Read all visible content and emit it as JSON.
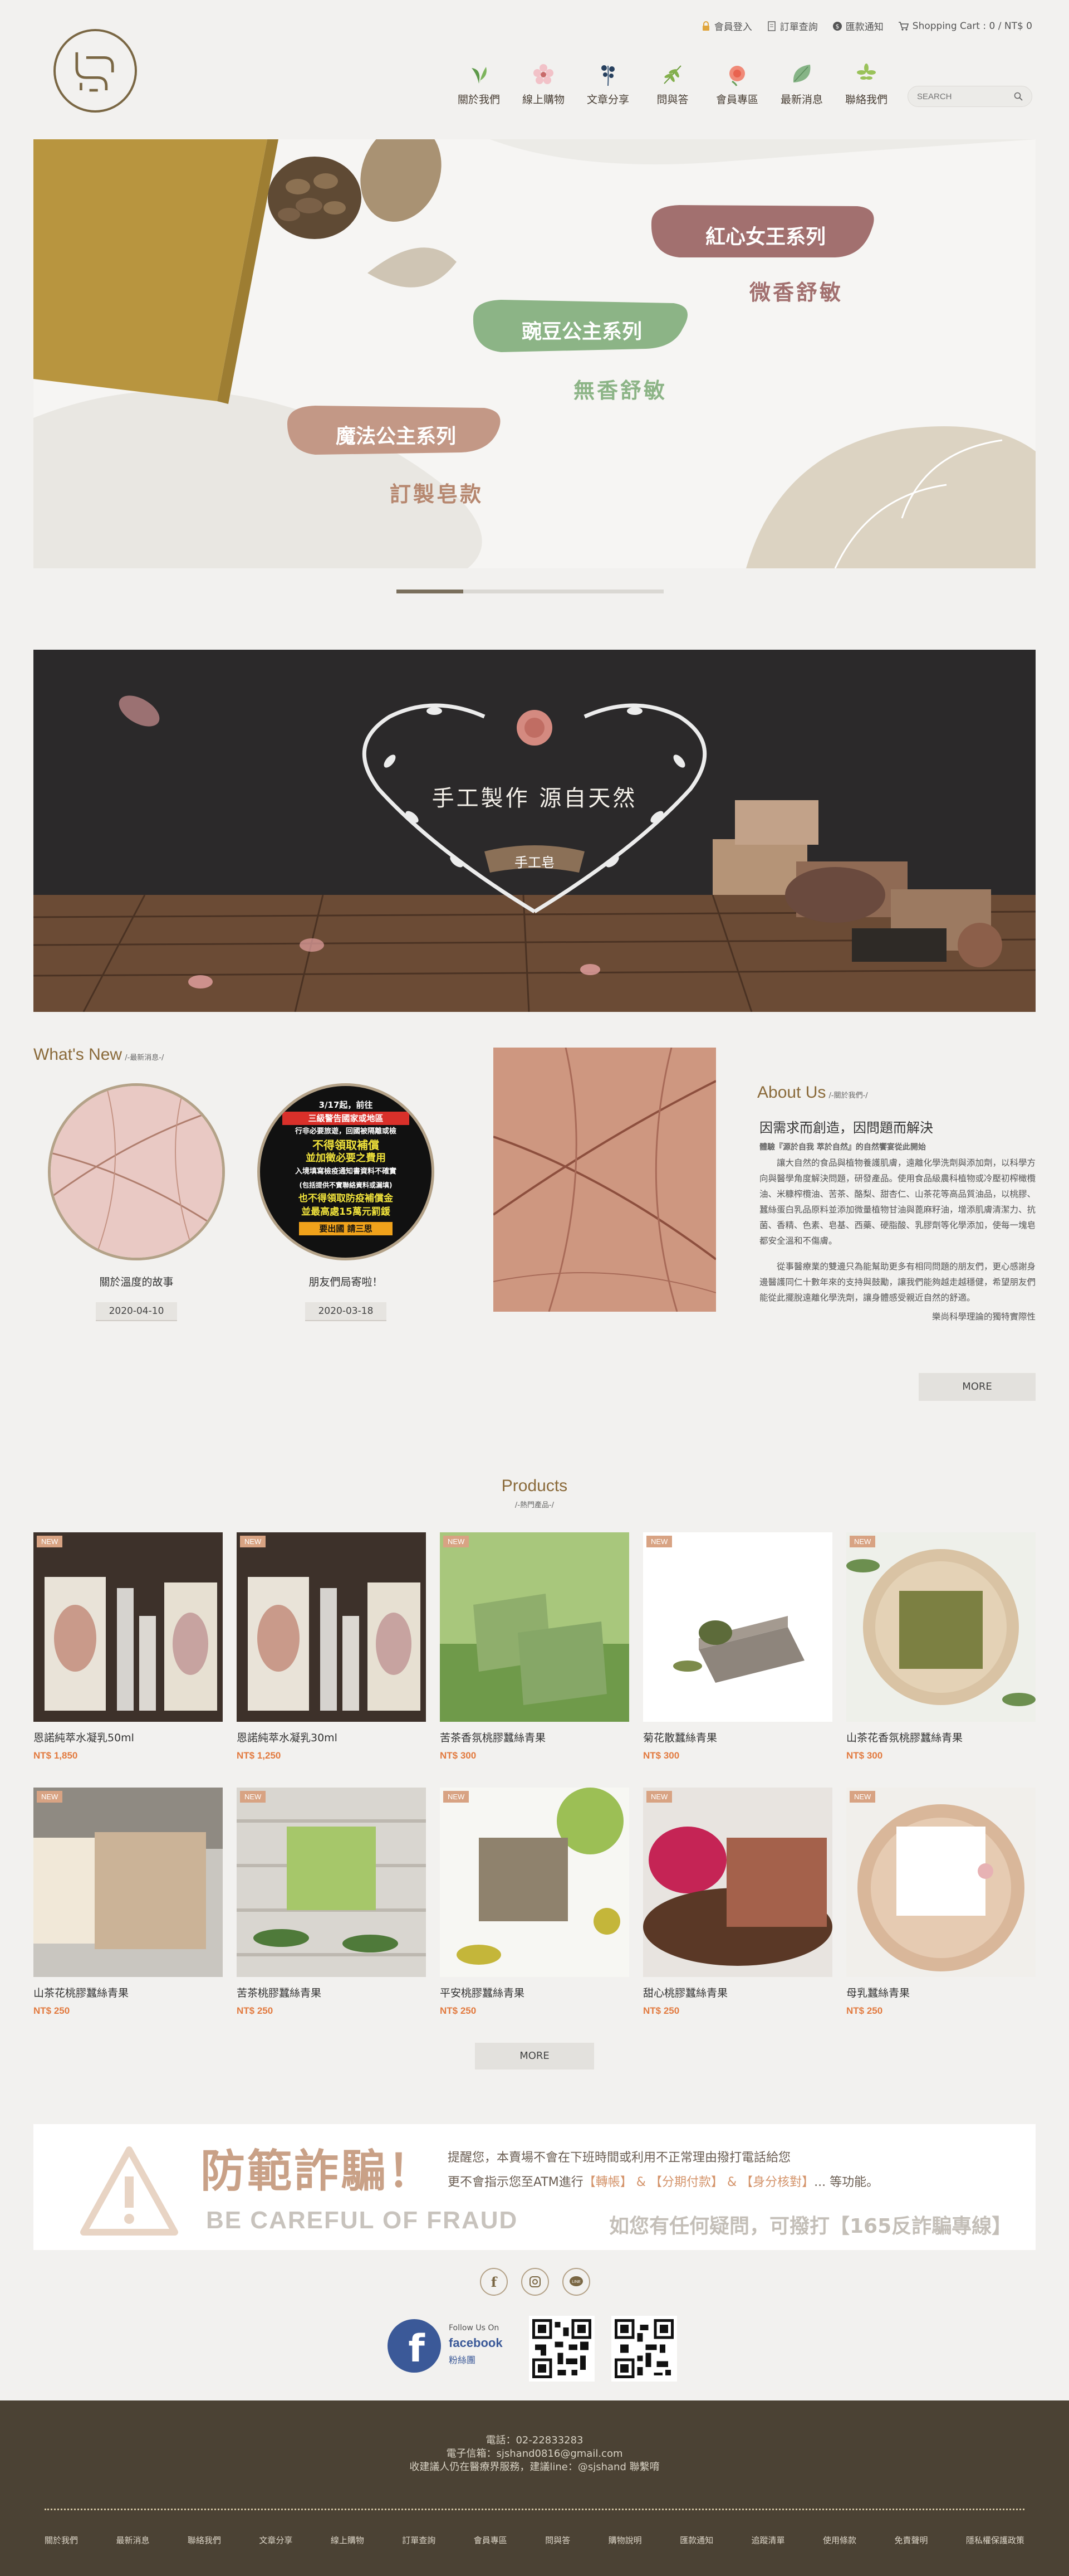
{
  "header": {
    "utility": [
      {
        "label": "會員登入",
        "icon": "lock-icon"
      },
      {
        "label": "訂單查詢",
        "icon": "document-icon"
      },
      {
        "label": "匯款通知",
        "icon": "dollar-icon"
      },
      {
        "label": "Shopping Cart : 0 / NT$ 0",
        "icon": "cart-icon"
      }
    ],
    "nav": [
      {
        "label": "關於我們",
        "icon": "leaf-sprout-icon"
      },
      {
        "label": "線上購物",
        "icon": "flower-icon"
      },
      {
        "label": "文章分享",
        "icon": "berries-icon"
      },
      {
        "label": "問與答",
        "icon": "fern-icon"
      },
      {
        "label": "會員專區",
        "icon": "pink-bloom-icon"
      },
      {
        "label": "最新消息",
        "icon": "green-leaf-icon"
      },
      {
        "label": "聯絡我們",
        "icon": "herb-icon"
      }
    ],
    "search_placeholder": "SEARCH"
  },
  "banner1": {
    "pill1": "紅心女王系列",
    "sub1": "微香舒敏",
    "pill2": "豌豆公主系列",
    "sub2": "無香舒敏",
    "pill3": "魔法公主系列",
    "sub3": "訂製皂款"
  },
  "banner2": {
    "headline": "手工製作 源自天然",
    "ribbon": "手工皂"
  },
  "news": {
    "title": "What's New",
    "subtitle": "/-最新消息-/",
    "items": [
      {
        "title": "關於溫度的故事",
        "date": "2020-04-10"
      },
      {
        "title": "朋友們局寄啦！",
        "date": "2020-03-18"
      }
    ],
    "poster_lines": [
      "3/17起，前往",
      "三級警告國家或地區",
      "行非必要旅遊，回國被隔離或檢",
      "不得領取補償",
      "並加徵必要之費用",
      "入境填寫檢疫通知書資料不確實",
      "(包括提供不實聯絡資料或漏填)",
      "也不得領取防疫補償金",
      "並最高處15萬元罰鍰",
      "要出國 請三思"
    ]
  },
  "about": {
    "title": "About Us",
    "subtitle": "/-關於我們-/",
    "heading": "因需求而創造，因問題而解決",
    "lead": "體驗『源於自我 萃於自然』的自然饗宴從此開始",
    "p1": "讓大自然的食品與植物養護肌膚，遠離化學洗劑與添加劑，以科學方向與醫學角度解決問題，研發產品。使用食品級農科植物或冷壓初榨橄欖油、米糠榨欖油、苦茶、酪梨、甜杏仁、山茶花等高品質油品，以桃膠、蠶絲蛋白乳品原料並添加微量植物甘油與蓖麻籽油，增添肌膚清潔力、抗菌、香精、色素、皂基、西藥、硬脂酸、乳膠劑等化學添加，使每一塊皂都安全溫和不傷膚。",
    "p2": "從事醫療業的雙邊只為能幫助更多有相同問題的朋友們，更心感謝身邊醫護同仁十數年來的支持與鼓勵，讓我們能夠越走越穩健，希望朋友們能從此擺脫遠離化學洗劑，讓身體感受親近自然的舒適。",
    "sign": "樂尚科學理論的獨特實際性",
    "more": "MORE"
  },
  "products": {
    "title": "Products",
    "subtitle": "/-熱門產品-/",
    "tag": "NEW",
    "items": [
      {
        "name": "恩諾純萃水凝乳50ml",
        "price": "NT$ 1,850"
      },
      {
        "name": "恩諾純萃水凝乳30ml",
        "price": "NT$ 1,250"
      },
      {
        "name": "苦茶香氛桃膠蠶絲青果",
        "price": "NT$ 300"
      },
      {
        "name": "菊花散蠶絲青果",
        "price": "NT$ 300"
      },
      {
        "name": "山茶花香氛桃膠蠶絲青果",
        "price": "NT$ 300"
      },
      {
        "name": "山茶花桃膠蠶絲青果",
        "price": "NT$ 250"
      },
      {
        "name": "苦茶桃膠蠶絲青果",
        "price": "NT$ 250"
      },
      {
        "name": "平安桃膠蠶絲青果",
        "price": "NT$ 250"
      },
      {
        "name": "甜心桃膠蠶絲青果",
        "price": "NT$ 250"
      },
      {
        "name": "母乳蠶絲青果",
        "price": "NT$ 250"
      }
    ],
    "more": "MORE"
  },
  "fraud": {
    "title": "防範詐騙！",
    "line1": "提醒您，本賣場不會在下班時間或利用不正常理由撥打電話給您",
    "line2a": "更不會指示您至ATM進行",
    "line2b": "【轉帳】",
    "line2c": "&",
    "line2d": "【分期付款】",
    "line2e": "&",
    "line2f": "【身分核對】",
    "line2g": "... 等功能。",
    "english": "BE CAREFUL OF FRAUD",
    "line3": "如您有任何疑問，可撥打【165反詐騙專線】"
  },
  "social": {
    "fb_follow": "Follow Us On",
    "fb_name": "facebook",
    "fb_fans": "粉絲團"
  },
  "footer": {
    "phone": "電話：02-22833283",
    "email": "電子信箱：sjshand0816@gmail.com",
    "line": "收建議人仍在醫療界服務，建議line：@sjshand 聯繫唷",
    "links": [
      "關於我們",
      "最新消息",
      "聯絡我們",
      "文章分享",
      "線上購物",
      "訂單查詢",
      "會員專區",
      "問與答",
      "購物說明",
      "匯款通知",
      "追蹤清單",
      "使用條款",
      "免責聲明",
      "隱私權保護政策"
    ]
  },
  "colors": {
    "brand": "#7a6744",
    "footer": "#4b4234",
    "price": "#e27a3f",
    "tag": "#d8a383"
  }
}
